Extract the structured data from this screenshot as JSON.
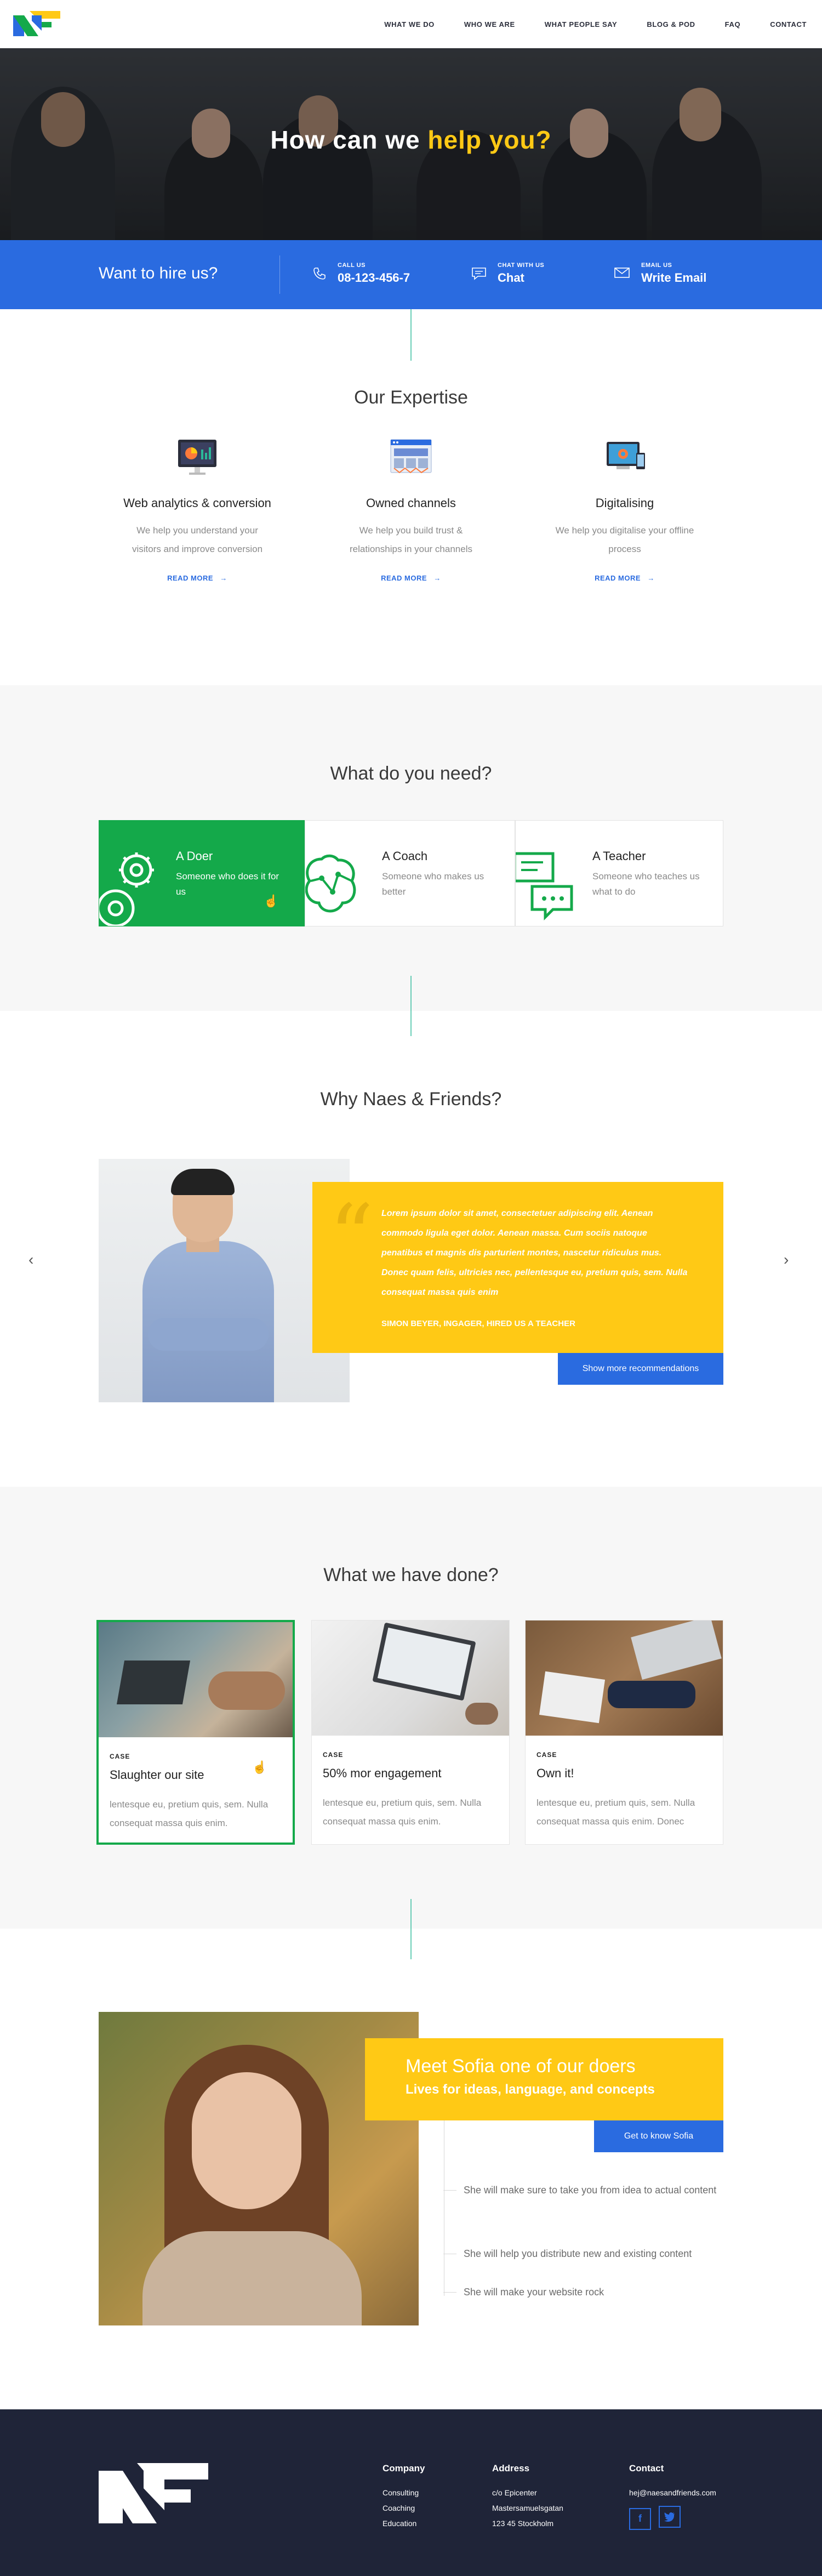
{
  "brand": {
    "logo_alt": "NF",
    "colors": {
      "blue": "#2a6be0",
      "yellow": "#ffc915",
      "green": "#14a94a",
      "navy": "#1f2438"
    }
  },
  "nav": {
    "items": [
      "WHAT WE DO",
      "WHO WE ARE",
      "WHAT PEOPLE SAY",
      "BLOG & POD",
      "FAQ",
      "CONTACT"
    ]
  },
  "hero": {
    "title_part1": "How can we ",
    "title_highlight": "help you?"
  },
  "hire": {
    "title": "Want to hire us?",
    "call": {
      "small": "CALL US",
      "big": "08-123-456-7",
      "icon": "phone-icon"
    },
    "chat": {
      "small": "CHAT WITH US",
      "big": "Chat",
      "icon": "chat-icon"
    },
    "email": {
      "small": "EMAIL US",
      "big": "Write Email",
      "icon": "mail-icon"
    }
  },
  "expertise": {
    "title": "Our Expertise",
    "items": [
      {
        "title": "Web analytics & conversion",
        "text1": "We help you understand your",
        "text2": "visitors and improve conversion",
        "link": "READ MORE",
        "icon": "analytics-monitor-icon"
      },
      {
        "title": "Owned channels",
        "text1": "We help you build  trust &",
        "text2": "relationships in your channels",
        "link": "READ MORE",
        "icon": "browser-window-icon"
      },
      {
        "title": "Digitalising",
        "text1": "We help you digitalise your offline",
        "text2": "process",
        "link": "READ MORE",
        "icon": "devices-gear-icon"
      }
    ]
  },
  "need": {
    "title": "What do you need?",
    "items": [
      {
        "title": "A Doer",
        "sub": "Someone who does it for us",
        "icon": "gears-icon"
      },
      {
        "title": "A Coach",
        "sub": "Someone who makes us better",
        "icon": "brain-circuit-icon"
      },
      {
        "title": "A Teacher",
        "sub": "Someone who teaches us what to do",
        "icon": "chat-bubbles-icon"
      }
    ]
  },
  "why": {
    "title": "Why Naes & Friends?",
    "quote": "Lorem ipsum dolor sit amet, consectetuer adipiscing elit. Aenean commodo ligula eget dolor. Aenean massa. Cum sociis natoque penatibus et magnis dis parturient montes, nascetur ridiculus mus. Donec quam felis, ultricies nec, pellentesque eu, pretium quis, sem. Nulla consequat massa quis enim",
    "author": "SIMON BEYER, INGAGER, HIRED US A TEACHER",
    "button": "Show more recommendations"
  },
  "cases": {
    "title": "What we have done?",
    "items": [
      {
        "tag": "CASE",
        "title": "Slaughter our site",
        "text": "lentesque eu, pretium quis, sem. Nulla consequat massa quis enim."
      },
      {
        "tag": "CASE",
        "title": "50% mor engagement",
        "text": "lentesque eu, pretium quis, sem. Nulla consequat massa quis enim."
      },
      {
        "tag": "CASE",
        "title": "Own it!",
        "text": "lentesque eu, pretium quis, sem. Nulla consequat massa quis enim. Donec"
      }
    ]
  },
  "meet": {
    "title": "Meet Sofia one of our doers",
    "sub": "Lives for ideas, language, and concepts",
    "button": "Get to know Sofia",
    "points": [
      "She will make sure to take you from idea to actual content",
      "She will help you distribute new and existing content",
      "She will make your website rock"
    ]
  },
  "footer": {
    "company": {
      "head": "Company",
      "lines": [
        "Consulting",
        "Coaching",
        "Education"
      ]
    },
    "address": {
      "head": "Address",
      "lines": [
        "c/o Epicenter",
        "Mastersamuelsgatan",
        "123 45 Stockholm"
      ]
    },
    "contact": {
      "head": "Contact",
      "email": "hej@naesandfriends.com",
      "social": [
        "facebook-icon",
        "twitter-icon"
      ]
    }
  }
}
